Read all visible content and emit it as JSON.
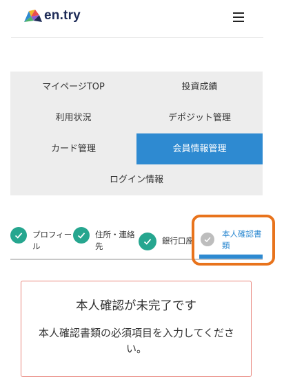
{
  "header": {
    "logo_text": "en.try",
    "menu_icon": "hamburger-menu-icon"
  },
  "nav": {
    "items": [
      {
        "label": "マイページTOP"
      },
      {
        "label": "投資成績"
      },
      {
        "label": "利用状況"
      },
      {
        "label": "デポジット管理"
      },
      {
        "label": "カード管理"
      },
      {
        "label": "会員情報管理",
        "active": true
      },
      {
        "label": "ログイン情報"
      }
    ]
  },
  "steps": [
    {
      "label_line1": "プロフィー",
      "label_line2": "ル",
      "status": "done"
    },
    {
      "label_line1": "住所・連絡",
      "label_line2": "先",
      "status": "done"
    },
    {
      "label_line1": "銀行口座",
      "label_line2": "",
      "status": "done"
    },
    {
      "label_line1": "本人確認書",
      "label_line2": "類",
      "status": "current"
    }
  ],
  "alert": {
    "title": "本人確認が未完了です",
    "body": "本人確認書類の必須項目を入力してください。"
  },
  "colors": {
    "accent": "#2e8ad1",
    "check": "#26a68f",
    "highlight": "#e8731c",
    "alert_border": "#e8837a"
  }
}
